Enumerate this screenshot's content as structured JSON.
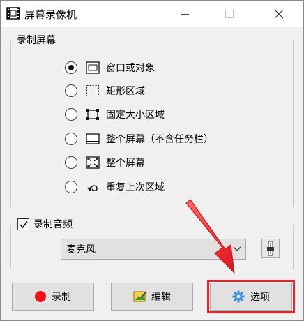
{
  "window": {
    "title": "屏幕录像机",
    "icons": {
      "app": "film-strip-icon",
      "minimize": "minimize-icon",
      "maximize": "maximize-icon",
      "close": "close-icon"
    }
  },
  "screen_group": {
    "legend": "录制屏幕",
    "options": [
      {
        "label": "窗口或对象",
        "icon": "window-icon",
        "checked": true
      },
      {
        "label": "矩形区域",
        "icon": "dashed-rectangle-icon",
        "checked": false
      },
      {
        "label": "固定大小区域",
        "icon": "fixed-size-frame-icon",
        "checked": false
      },
      {
        "label": "整个屏幕（不含任务栏）",
        "icon": "screen-without-taskbar-icon",
        "checked": false
      },
      {
        "label": "整个屏幕",
        "icon": "fullscreen-icon",
        "checked": false
      },
      {
        "label": "重复上次区域",
        "icon": "repeat-arrow-icon",
        "checked": false
      }
    ]
  },
  "audio_group": {
    "legend": "录制音频",
    "checked": true,
    "device": "麦克风",
    "icons": {
      "dropdown": "chevron-down-icon",
      "mixer": "mixer-slider-icon"
    }
  },
  "buttons": {
    "record": "录制",
    "edit": "编辑",
    "options": "选项",
    "icons": {
      "record": "record-dot-icon",
      "edit": "edit-image-icon",
      "options": "gear-icon"
    }
  },
  "colors": {
    "record": "#e8141a",
    "highlight": "#e3262c"
  }
}
